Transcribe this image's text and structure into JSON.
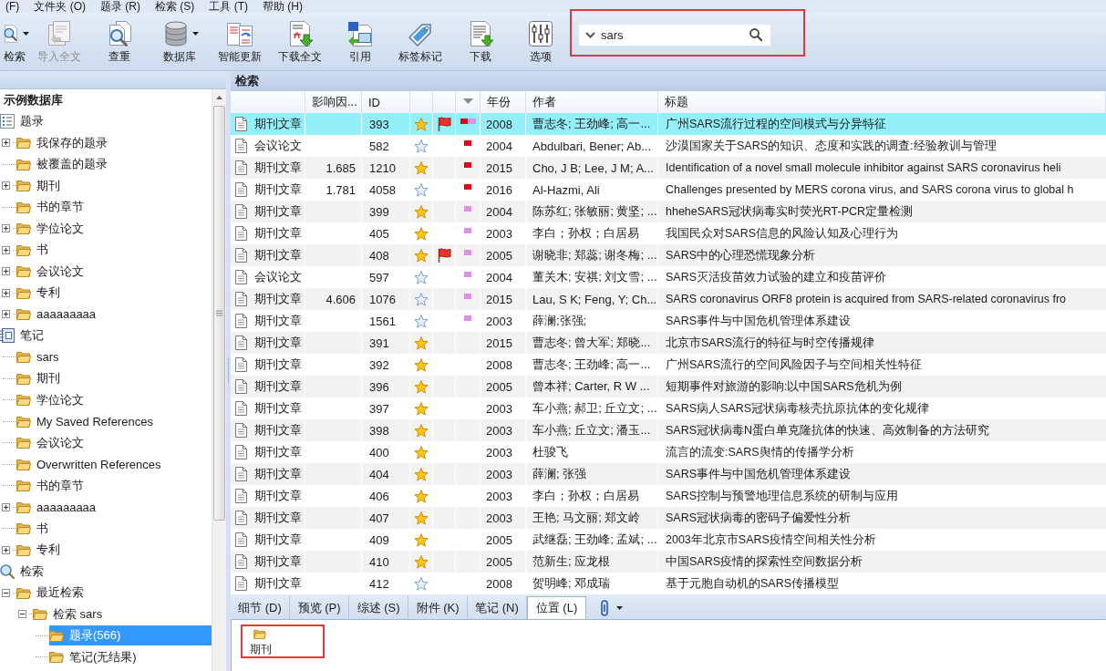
{
  "menu": [
    {
      "label": "(F)"
    },
    {
      "label": "文件夹 (O)"
    },
    {
      "label": "题录 (R)"
    },
    {
      "label": "检索 (S)"
    },
    {
      "label": "工具 (T)"
    },
    {
      "label": "帮助 (H)"
    }
  ],
  "toolbar": [
    {
      "kind": "search",
      "label": "检索",
      "dropdown": true,
      "disabled": false
    },
    {
      "kind": "import",
      "label": "导入全文",
      "dropdown": false,
      "disabled": true
    },
    {
      "kind": "dedupe",
      "label": "查重",
      "dropdown": false,
      "disabled": false
    },
    {
      "kind": "database",
      "label": "数据库",
      "dropdown": true,
      "disabled": false
    },
    {
      "kind": "update",
      "label": "智能更新",
      "dropdown": false,
      "disabled": false
    },
    {
      "kind": "fulltext",
      "label": "下载全文",
      "dropdown": false,
      "disabled": false
    },
    {
      "kind": "cite",
      "label": "引用",
      "dropdown": false,
      "disabled": false
    },
    {
      "kind": "tag",
      "label": "标签标记",
      "dropdown": false,
      "disabled": false
    },
    {
      "kind": "download",
      "label": "下载",
      "dropdown": false,
      "disabled": false
    },
    {
      "kind": "options",
      "label": "选项",
      "dropdown": false,
      "disabled": false
    }
  ],
  "search": {
    "value": "sars"
  },
  "sidebar": {
    "tree": [
      {
        "kind": "library",
        "label": "示例数据库",
        "selected": false,
        "children": [
          {
            "kind": "list",
            "label": "题录",
            "selected": false,
            "children": [
              {
                "kind": "folder",
                "label": "我保存的题录",
                "selected": false,
                "expanded": false
              },
              {
                "kind": "folder",
                "label": "被覆盖的题录",
                "selected": false
              },
              {
                "kind": "folder",
                "label": "期刊",
                "selected": false,
                "expanded": false
              },
              {
                "kind": "folder",
                "label": "书的章节",
                "selected": false
              },
              {
                "kind": "folder",
                "label": "学位论文",
                "selected": false,
                "expanded": false
              },
              {
                "kind": "folder",
                "label": "书",
                "selected": false,
                "expanded": false
              },
              {
                "kind": "folder",
                "label": "会议论文",
                "selected": false,
                "expanded": false
              },
              {
                "kind": "folder",
                "label": "专利",
                "selected": false,
                "expanded": false
              },
              {
                "kind": "folder",
                "label": "aaaaaaaaa",
                "selected": false,
                "expanded": false
              }
            ]
          },
          {
            "kind": "notebook",
            "label": "笔记",
            "selected": false,
            "children": [
              {
                "kind": "folder",
                "label": "sars",
                "selected": false
              },
              {
                "kind": "folder",
                "label": "期刊",
                "selected": false
              },
              {
                "kind": "folder",
                "label": "学位论文",
                "selected": false
              },
              {
                "kind": "folder",
                "label": "My Saved References",
                "selected": false
              },
              {
                "kind": "folder",
                "label": "会议论文",
                "selected": false
              },
              {
                "kind": "folder",
                "label": "Overwritten References",
                "selected": false
              },
              {
                "kind": "folder",
                "label": "书的章节",
                "selected": false
              },
              {
                "kind": "folder",
                "label": "aaaaaaaaa",
                "selected": false,
                "expanded": false
              },
              {
                "kind": "folder",
                "label": "书",
                "selected": false
              },
              {
                "kind": "folder",
                "label": "专利",
                "selected": false,
                "expanded": false
              }
            ]
          },
          {
            "kind": "search",
            "label": "检索",
            "selected": false,
            "children": [
              {
                "kind": "folder",
                "label": "最近检索",
                "selected": false,
                "expanded": true,
                "children": [
                  {
                    "kind": "folder",
                    "label": "检索 sars",
                    "selected": false,
                    "expanded": true,
                    "children": [
                      {
                        "kind": "folder",
                        "label": "题录(566)",
                        "selected": true
                      },
                      {
                        "kind": "folder",
                        "label": "笔记(无结果)",
                        "selected": false
                      }
                    ]
                  }
                ]
              }
            ]
          }
        ]
      }
    ]
  },
  "panel": {
    "title": "检索"
  },
  "table": {
    "columns": [
      {
        "sorted": false
      },
      {
        "label": "影响因...",
        "sorted": false
      },
      {
        "label": "ID",
        "sorted": false
      },
      {
        "sorted": false
      },
      {
        "sorted": false
      },
      {
        "sorted": true
      },
      {
        "label": "年份",
        "sorted": false
      },
      {
        "label": "作者",
        "sorted": false
      },
      {
        "label": "标题",
        "sorted": false
      }
    ],
    "rows": [
      {
        "selected": true,
        "column_1": "期刊文章",
        "id": "393",
        "starred": true,
        "flagged": true,
        "tags": [
          {
            "color": "#e8001c"
          },
          {
            "color": "#e090e8"
          }
        ],
        "year": "2008",
        "authors": "曹志冬; 王劲峰; 高一...",
        "title": "广州SARS流行过程的空间模式与分异特征"
      },
      {
        "selected": false,
        "column_1": "会议论文",
        "id": "582",
        "starred": false,
        "flagged": false,
        "tags": [
          {
            "color": "#e8001c"
          }
        ],
        "year": "2004",
        "authors": "Abdulbari, Bener; Ab...",
        "title": "沙漠国家关于SARS的知识、态度和实践的调查:经验教训与管理"
      },
      {
        "selected": false,
        "column_1": "期刊文章",
        "column_2": "1.685",
        "id": "1210",
        "starred": true,
        "flagged": false,
        "tags": [
          {
            "color": "#e8001c"
          }
        ],
        "year": "2015",
        "authors": "Cho, J B; Lee, J M; A...",
        "title": "Identification of a novel small molecule inhibitor against SARS coronavirus heli"
      },
      {
        "selected": false,
        "column_1": "期刊文章",
        "column_2": "1.781",
        "id": "4058",
        "starred": false,
        "flagged": false,
        "tags": [
          {
            "color": "#e8001c"
          }
        ],
        "year": "2016",
        "authors": "Al-Hazmi, Ali",
        "title": "Challenges presented by MERS corona virus, and SARS corona virus to global h"
      },
      {
        "selected": false,
        "column_1": "期刊文章",
        "id": "399",
        "starred": true,
        "flagged": false,
        "tags": [
          {
            "color": "#e090e8"
          }
        ],
        "year": "2004",
        "authors": "陈苏红; 张敏丽; 黄坚; ...",
        "title": "hheheSARS冠状病毒实时荧光RT-PCR定量检测"
      },
      {
        "selected": false,
        "column_1": "期刊文章",
        "id": "405",
        "starred": true,
        "flagged": false,
        "tags": [
          {
            "color": "#e090e8"
          }
        ],
        "year": "2003",
        "authors": "李白；孙权；白居易",
        "title": "我国民众对SARS信息的风险认知及心理行为"
      },
      {
        "selected": false,
        "column_1": "期刊文章",
        "id": "408",
        "starred": true,
        "flagged": true,
        "tags": [
          {
            "color": "#e090e8"
          }
        ],
        "year": "2005",
        "authors": "谢晓非; 郑蕊; 谢冬梅; ...",
        "title": "SARS中的心理恐慌现象分析"
      },
      {
        "selected": false,
        "column_1": "会议论文",
        "id": "597",
        "starred": false,
        "flagged": false,
        "tags": [
          {
            "color": "#e090e8"
          }
        ],
        "year": "2004",
        "authors": "董关木; 安祺; 刘文雪; ...",
        "title": "SARS灭活疫苗效力试验的建立和疫苗评价"
      },
      {
        "selected": false,
        "column_1": "期刊文章",
        "column_2": "4.606",
        "id": "1076",
        "starred": false,
        "flagged": false,
        "tags": [
          {
            "color": "#e090e8"
          }
        ],
        "year": "2015",
        "authors": "Lau, S K; Feng, Y; Ch...",
        "title": "SARS coronavirus ORF8 protein is acquired from SARS-related coronavirus fro"
      },
      {
        "selected": false,
        "column_1": "期刊文章",
        "id": "1561",
        "starred": false,
        "flagged": false,
        "tags": [
          {
            "color": "#e090e8"
          }
        ],
        "year": "2003",
        "authors": "薛澜;张强;",
        "title": "SARS事件与中国危机管理体系建设"
      },
      {
        "selected": false,
        "column_1": "期刊文章",
        "id": "391",
        "starred": true,
        "flagged": false,
        "year": "2015",
        "authors": "曹志冬; 曾大军; 郑晓...",
        "title": "北京市SARS流行的特征与时空传播规律"
      },
      {
        "selected": false,
        "column_1": "期刊文章",
        "id": "392",
        "starred": true,
        "flagged": false,
        "year": "2008",
        "authors": "曹志冬; 王劲峰; 高一...",
        "title": "广州SARS流行的空间风险因子与空间相关性特征"
      },
      {
        "selected": false,
        "column_1": "期刊文章",
        "id": "396",
        "starred": true,
        "flagged": false,
        "year": "2005",
        "authors": "曾本祥; Carter, R W ...",
        "title": "短期事件对旅游的影响:以中国SARS危机为例"
      },
      {
        "selected": false,
        "column_1": "期刊文章",
        "id": "397",
        "starred": true,
        "flagged": false,
        "year": "2003",
        "authors": "车小燕; 郝卫; 丘立文; ...",
        "title": "SARS病人SARS冠状病毒核壳抗原抗体的变化规律"
      },
      {
        "selected": false,
        "column_1": "期刊文章",
        "id": "398",
        "starred": true,
        "flagged": false,
        "year": "2003",
        "authors": "车小燕; 丘立文; 潘玉...",
        "title": "SARS冠状病毒N蛋白单克隆抗体的快速、高效制备的方法研究"
      },
      {
        "selected": false,
        "column_1": "期刊文章",
        "id": "400",
        "starred": true,
        "flagged": false,
        "year": "2003",
        "authors": "杜骏飞",
        "title": "流言的流变:SARS舆情的传播学分析"
      },
      {
        "selected": false,
        "column_1": "期刊文章",
        "id": "404",
        "starred": true,
        "flagged": false,
        "year": "2003",
        "authors": "薛澜; 张强",
        "title": "SARS事件与中国危机管理体系建设"
      },
      {
        "selected": false,
        "column_1": "期刊文章",
        "id": "406",
        "starred": true,
        "flagged": false,
        "year": "2003",
        "authors": "李白；孙权；白居易",
        "title": "SARS控制与预警地理信息系统的研制与应用"
      },
      {
        "selected": false,
        "column_1": "期刊文章",
        "id": "407",
        "starred": true,
        "flagged": false,
        "year": "2003",
        "authors": "王艳; 马文丽; 郑文岭",
        "title": "SARS冠状病毒的密码子偏爱性分析"
      },
      {
        "selected": false,
        "column_1": "期刊文章",
        "id": "409",
        "starred": true,
        "flagged": false,
        "year": "2005",
        "authors": "武继磊; 王劲峰; 孟斌; ...",
        "title": "2003年北京市SARS疫情空间相关性分析"
      },
      {
        "selected": false,
        "column_1": "期刊文章",
        "id": "410",
        "starred": true,
        "flagged": false,
        "year": "2005",
        "authors": "范新生; 应龙根",
        "title": "中国SARS疫情的探索性空间数据分析"
      },
      {
        "selected": false,
        "column_1": "期刊文章",
        "id": "412",
        "starred": false,
        "flagged": false,
        "year": "2008",
        "authors": "贺明峰; 邓成瑞",
        "title": "基于元胞自动机的SARS传播模型"
      }
    ]
  },
  "tabs": [
    {
      "label": "细节 (D)",
      "selected": false
    },
    {
      "label": "预览 (P)",
      "selected": false
    },
    {
      "label": "综述 (S)",
      "selected": false
    },
    {
      "label": "附件 (K)",
      "selected": false
    },
    {
      "label": "笔记 (N)",
      "selected": false
    },
    {
      "label": "位置 (L)",
      "selected": true
    }
  ],
  "location": {
    "items": [
      {
        "label": "期刊"
      }
    ]
  }
}
